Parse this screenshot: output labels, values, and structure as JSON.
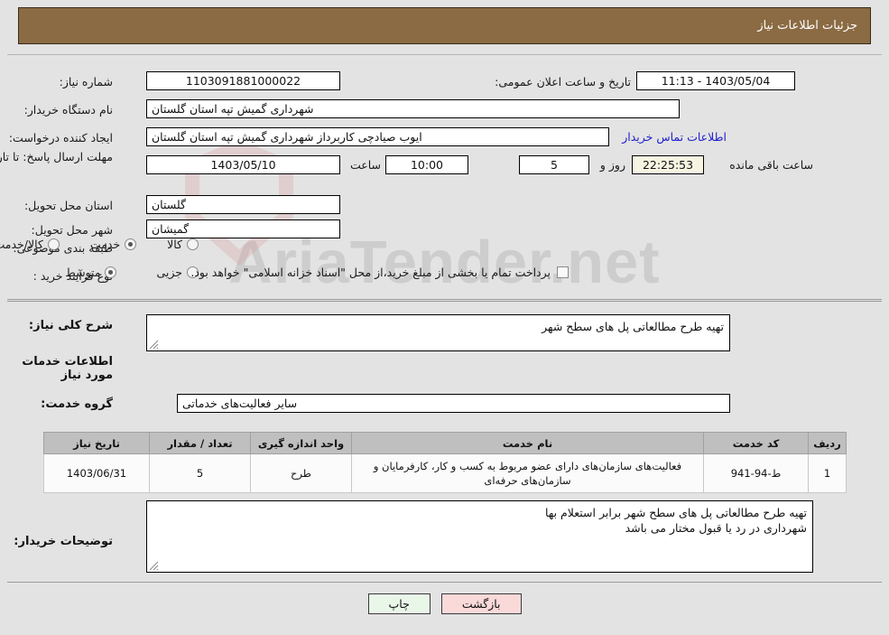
{
  "header": {
    "title": "جزئیات اطلاعات نیاز",
    "bg_color": "#8b6b43"
  },
  "watermark": {
    "text": "AriaTender.net"
  },
  "form": {
    "need_number": {
      "label": "شماره نیاز:",
      "value": "1103091881000022"
    },
    "announce_datetime": {
      "label": "تاریخ و ساعت اعلان عمومی:",
      "value": "1403/05/04 - 11:13"
    },
    "buyer_org": {
      "label": "نام دستگاه خریدار:",
      "value": "شهرداری گمیش تپه استان گلستان"
    },
    "requester": {
      "label": "ایجاد کننده درخواست:",
      "value": "ایوب صیادچی کاربرداز شهرداری گمیش تپه استان گلستان"
    },
    "contact_link": {
      "text": "اطلاعات تماس خریدار"
    },
    "deadline": {
      "label": "مهلت ارسال پاسخ: تا تاریخ:",
      "date": "1403/05/10",
      "time_label": "ساعت",
      "time": "10:00",
      "days": "5",
      "days_label": "روز و",
      "countdown": "22:25:53",
      "countdown_suffix": "ساعت باقی مانده"
    },
    "province": {
      "label": "استان محل تحویل:",
      "value": "گلستان"
    },
    "city": {
      "label": "شهر محل تحویل:",
      "value": "گمیشان"
    },
    "category": {
      "label": "طبقه بندی موضوعی:",
      "options": [
        {
          "label": "کالا",
          "selected": false
        },
        {
          "label": "خدمت",
          "selected": true
        },
        {
          "label": "کالا/خدمت",
          "selected": false
        }
      ]
    },
    "purchase_type": {
      "label": "نوع فرآیند خرید :",
      "options": [
        {
          "label": "جزیی",
          "selected": false
        },
        {
          "label": "متوسط",
          "selected": true
        }
      ],
      "checkbox": {
        "label": "پرداخت تمام یا بخشی از مبلغ خرید،از محل \"اسناد خزانه اسلامی\" خواهد بود.",
        "checked": false
      }
    }
  },
  "need_summary": {
    "label": "شرح کلی نیاز:",
    "value": "تهیه طرح مطالعاتی پل های سطح شهر"
  },
  "services_section": {
    "heading": "اطلاعات خدمات مورد نیاز",
    "service_group": {
      "label": "گروه خدمت:",
      "value": "سایر فعالیت‌های خدماتی"
    },
    "table": {
      "columns": [
        "ردیف",
        "کد خدمت",
        "نام خدمت",
        "واحد اندازه گیری",
        "تعداد / مقدار",
        "تاریخ نیاز"
      ],
      "rows": [
        {
          "index": "1",
          "code": "ط-94-941",
          "name": "فعالیت‌های سازمان‌های دارای عضو مربوط به کسب و کار، کارفرمایان و سازمان‌های حرفه‌ای",
          "unit": "طرح",
          "quantity": "5",
          "need_date": "1403/06/31"
        }
      ]
    }
  },
  "buyer_notes": {
    "label": "توضیحات خریدار:",
    "line1": "تهیه طرح مطالعاتی پل های سطح شهر برابر استعلام بها",
    "line2": "شهرداری در رد یا قبول مختار می باشد"
  },
  "buttons": {
    "print": "چاپ",
    "back": "بازگشت"
  }
}
